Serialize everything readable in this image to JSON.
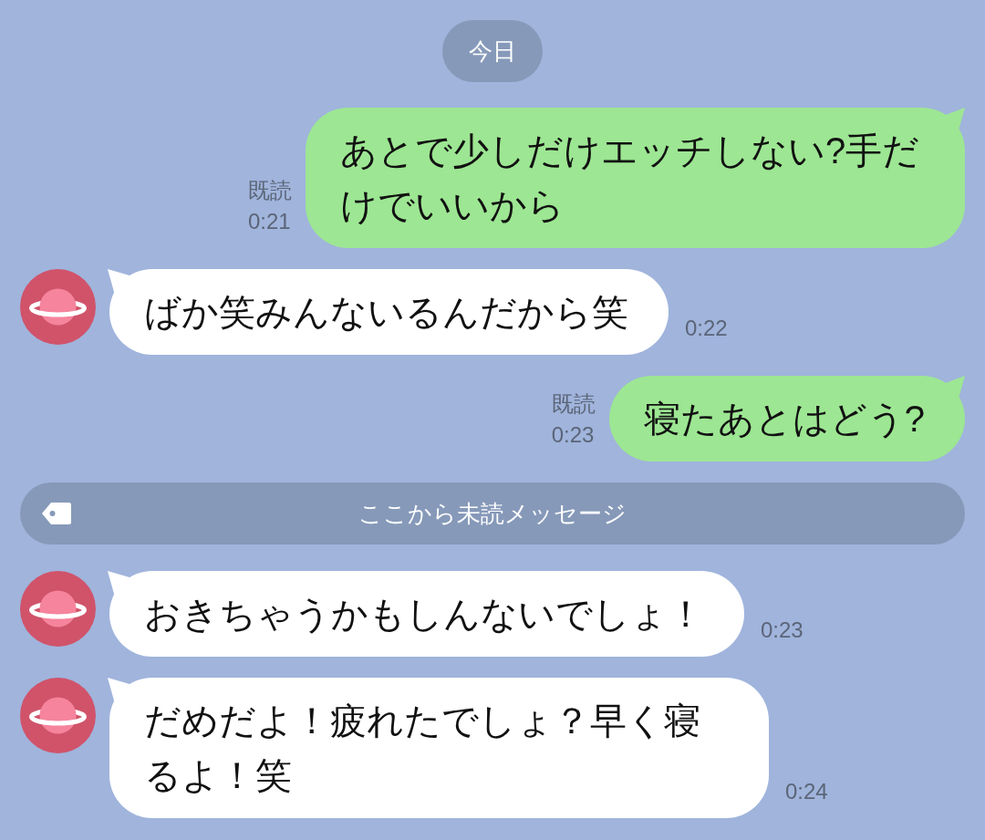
{
  "date_separator": {
    "label": "今日"
  },
  "messages": [
    {
      "kind": "sent",
      "text": "あとで少しだけエッチしない?手だけでいいから",
      "read_label": "既読",
      "time": "0:21"
    },
    {
      "kind": "received",
      "text": "ばか笑みんないるんだから笑",
      "time": "0:22"
    },
    {
      "kind": "sent",
      "text": "寝たあとはどう?",
      "read_label": "既読",
      "time": "0:23"
    },
    {
      "kind": "unread_divider",
      "label": "ここから未読メッセージ"
    },
    {
      "kind": "received",
      "text": "おきちゃうかもしんないでしょ！",
      "time": "0:23"
    },
    {
      "kind": "received",
      "text": "だめだよ！疲れたでしょ？早く寝るよ！笑",
      "time": "0:24"
    }
  ]
}
